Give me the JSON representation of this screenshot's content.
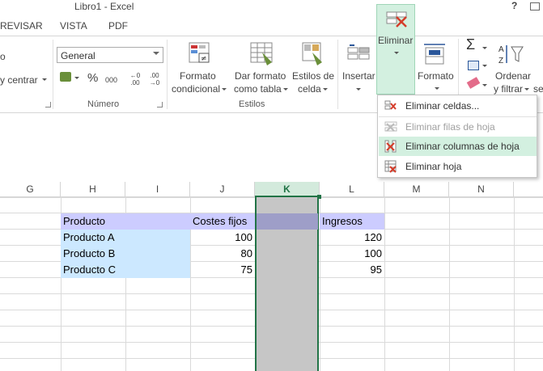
{
  "window": {
    "title": "Libro1 - Excel",
    "help": "?"
  },
  "tabs": [
    {
      "label": "REVISAR"
    },
    {
      "label": "VISTA"
    },
    {
      "label": "PDF"
    }
  ],
  "ribbon": {
    "alignment_fragment_top": "o",
    "alignment_fragment_bottom": "y centrar",
    "number_format": "General",
    "currency_symbol": "₹",
    "percent": "%",
    "thousands": "000",
    "dec_increase": "←0 .00",
    "dec_decrease": ".00 →0",
    "groups": {
      "numero": "Número",
      "estilos": "Estilos"
    },
    "buttons": {
      "formato_condicional_1": "Formato",
      "formato_condicional_2": "condicional",
      "dar_formato_1": "Dar formato",
      "dar_formato_2": "como tabla",
      "estilos_celda_1": "Estilos de",
      "estilos_celda_2": "celda",
      "insertar": "Insertar",
      "eliminar": "Eliminar",
      "formato": "Formato",
      "ordenar_1": "Ordenar",
      "ordenar_2": "y filtrar",
      "fragment_se": "se"
    }
  },
  "dropdown": {
    "items": [
      {
        "label": "Eliminar celdas...",
        "enabled": true,
        "highlighted": false
      },
      {
        "label": "Eliminar filas de hoja",
        "enabled": false,
        "highlighted": false
      },
      {
        "label": "Eliminar columnas de hoja",
        "enabled": true,
        "highlighted": true
      },
      {
        "label": "Eliminar hoja",
        "enabled": true,
        "highlighted": false
      }
    ]
  },
  "sheet": {
    "columns": [
      "G",
      "H",
      "I",
      "J",
      "K",
      "L",
      "M",
      "N"
    ],
    "selected_column": "K",
    "headers": {
      "producto": "Producto",
      "costes": "Costes fijos",
      "ingresos": "Ingresos"
    },
    "rows": [
      {
        "producto": "Producto A",
        "costes": "100",
        "ingresos": "120"
      },
      {
        "producto": "Producto B",
        "costes": "80",
        "ingresos": "100"
      },
      {
        "producto": "Producto C",
        "costes": "75",
        "ingresos": "95"
      }
    ]
  },
  "colors": {
    "accent": "#217346",
    "header_fill": "#ccccff",
    "product_fill": "#cce8ff",
    "selection": "#c6c6c6",
    "highlight": "#d3f0e0"
  }
}
